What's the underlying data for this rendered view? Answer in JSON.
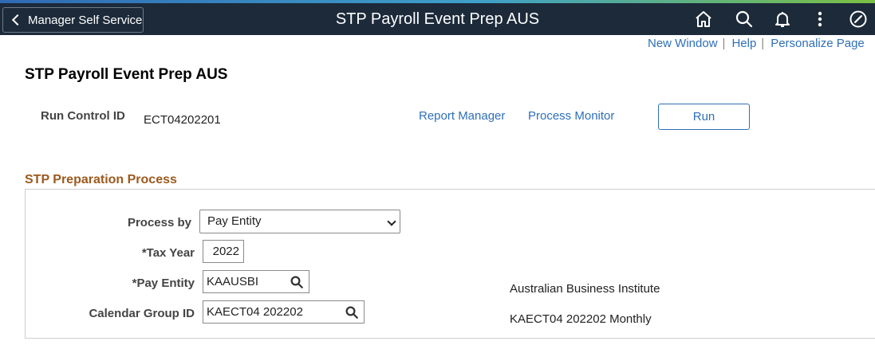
{
  "topbar": {
    "back_label": "Manager Self Service",
    "title": "STP Payroll Event Prep AUS",
    "icons": [
      "home-icon",
      "search-icon",
      "bell-icon",
      "more-vertical-icon",
      "compass-icon"
    ]
  },
  "links": {
    "new_window": "New Window",
    "help": "Help",
    "personalize": "Personalize Page",
    "separator": "|"
  },
  "page": {
    "title": "STP Payroll Event Prep AUS"
  },
  "run_control": {
    "label": "Run Control ID",
    "value": "ECT04202201",
    "report_manager": "Report Manager",
    "process_monitor": "Process Monitor",
    "run_button": "Run"
  },
  "section": {
    "title": "STP Preparation Process",
    "process_by": {
      "label": "Process by",
      "value": "Pay Entity"
    },
    "tax_year": {
      "label": "*Tax Year",
      "value": "2022"
    },
    "pay_entity": {
      "label": "*Pay Entity",
      "value": "KAAUSBI",
      "description": "Australian Business Institute"
    },
    "calendar_group": {
      "label": "Calendar Group ID",
      "value": "KAECT04 202202",
      "description": "KAECT04 202202 Monthly"
    }
  },
  "colors": {
    "topbar": "#1c2a3a",
    "link": "#2e6fb7",
    "section_title": "#9c5a1e"
  }
}
